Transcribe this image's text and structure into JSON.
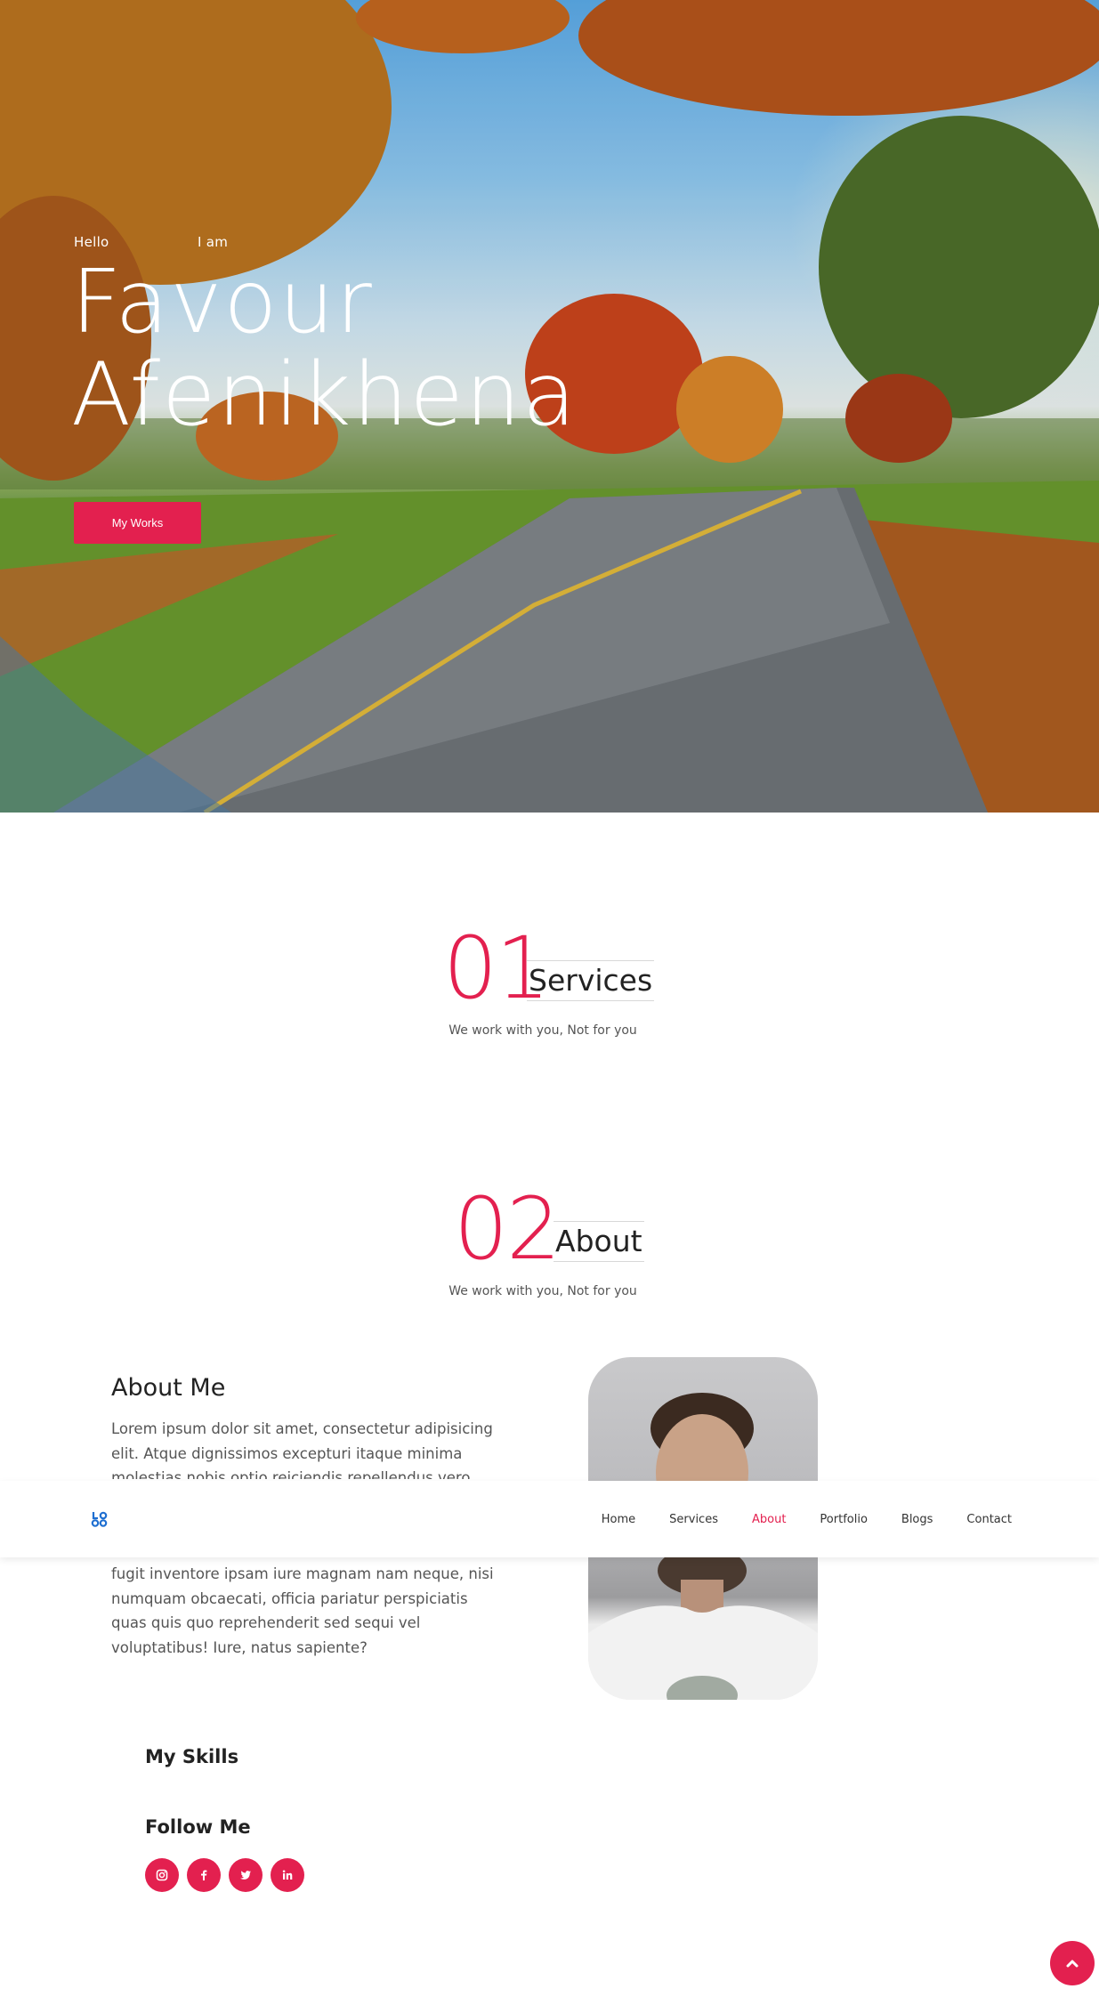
{
  "hero": {
    "hello": "Hello",
    "iam": "I am",
    "name_line1": "Favour",
    "name_line2": "Afenikhena",
    "button": "My Works"
  },
  "services": {
    "number": "01",
    "title": "Services",
    "subtitle": "We work with you, Not for you"
  },
  "about": {
    "number": "02",
    "title": "About",
    "subtitle": "We work with you, Not for you",
    "heading": "About Me",
    "text_top": "Lorem ipsum dolor sit amet, consectetur adipisicing elit. Atque dignissimos excepturi itaque minima molestias nobis optio reiciendis repellendus vero",
    "text_bottom": "fugit inventore ipsam iure magnam nam neque, nisi numquam obcaecati, officia pariatur perspiciatis quas quis quo reprehenderit sed sequi vel voluptatibus! Iure, natus sapiente?"
  },
  "nav": {
    "logo": "LOGO",
    "items": [
      {
        "label": "Home"
      },
      {
        "label": "Services"
      },
      {
        "label": "About"
      },
      {
        "label": "Portfolio"
      },
      {
        "label": "Blogs"
      },
      {
        "label": "Contact"
      }
    ],
    "active": "About"
  },
  "skills": {
    "heading": "My Skills"
  },
  "follow": {
    "heading": "Follow Me",
    "icons": [
      "instagram-icon",
      "facebook-icon",
      "twitter-icon",
      "linkedin-icon"
    ]
  },
  "colors": {
    "accent": "#e3204f",
    "logo": "#1f6fd1"
  }
}
